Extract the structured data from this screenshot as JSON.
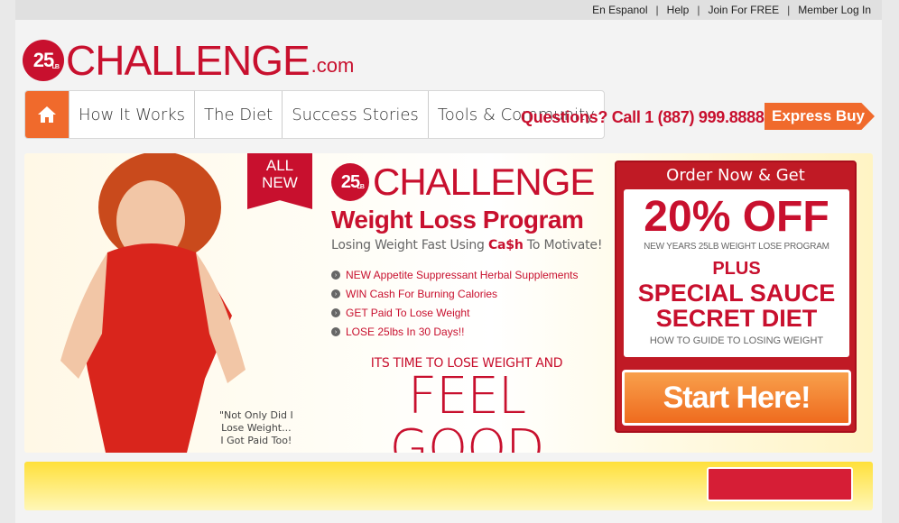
{
  "top_links": [
    "En Espanol",
    "Help",
    "Join For FREE",
    "Member Log In"
  ],
  "logo": {
    "badge": "25",
    "badge_sub": "LB",
    "word": "CHALLENGE",
    ".com": ".com"
  },
  "nav": {
    "items": [
      "How It Works",
      "The Diet",
      "Success Stories",
      "Tools & Community"
    ]
  },
  "questions": "Questions? Call 1 (887) 999.8888",
  "express": "Express Buy",
  "hero": {
    "ribbon_1": "ALL",
    "ribbon_2": "NEW",
    "quote_1": "\"Not Only Did I",
    "quote_2": "Lose Weight...",
    "quote_3": "I Got Paid Too!",
    "center_badge": "25",
    "center_badge_sub": "LB",
    "center_word": "CHALLENGE",
    "program": "Weight Loss Program",
    "tag_pre": "Losing Weight Fast Using ",
    "tag_bold": "Ca$h",
    "tag_post": " To Motivate!",
    "bullets": [
      "NEW Appetite Suppressant Herbal Supplements",
      "WIN Cash For Burning Calories",
      "GET Paid To Lose Weight",
      "LOSE 25lbs In 30 Days!!"
    ],
    "time": "ITS TIME TO LOSE WEIGHT AND",
    "feel": "FEEL GOOD"
  },
  "order": {
    "head": "Order Now & Get",
    "off": "20% OFF",
    "sub": "NEW YEARS 25LB WEIGHT LOSE PROGRAM",
    "plus": "PLUS",
    "sauce_1": "SPECIAL SAUCE",
    "sauce_2": "SECRET DIET",
    "howto": "HOW TO GUIDE TO LOSING WEIGHT",
    "start": "Start Here!"
  }
}
